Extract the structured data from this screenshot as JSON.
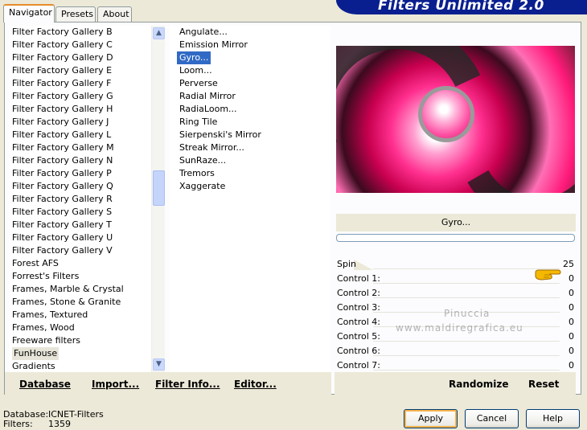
{
  "banner_title": "Filters Unlimited 2.0",
  "tabs": [
    {
      "label": "Navigator",
      "active": true
    },
    {
      "label": "Presets",
      "active": false
    },
    {
      "label": "About",
      "active": false
    }
  ],
  "categories": [
    "Filter Factory Gallery B",
    "Filter Factory Gallery C",
    "Filter Factory Gallery D",
    "Filter Factory Gallery E",
    "Filter Factory Gallery F",
    "Filter Factory Gallery G",
    "Filter Factory Gallery H",
    "Filter Factory Gallery J",
    "Filter Factory Gallery L",
    "Filter Factory Gallery M",
    "Filter Factory Gallery N",
    "Filter Factory Gallery P",
    "Filter Factory Gallery Q",
    "Filter Factory Gallery R",
    "Filter Factory Gallery S",
    "Filter Factory Gallery T",
    "Filter Factory Gallery U",
    "Filter Factory Gallery V",
    "Forest AFS",
    "Forrest's Filters",
    "Frames, Marble & Crystal",
    "Frames, Stone & Granite",
    "Frames, Textured",
    "Frames, Wood",
    "Freeware filters",
    "FunHouse",
    "Gradients"
  ],
  "selected_category": "FunHouse",
  "filters": [
    "Angulate...",
    "Emission Mirror",
    "Gyro...",
    "Loom...",
    "Perverse",
    "Radial Mirror",
    "RadiaLoom...",
    "Ring Tile",
    "Sierpenski's Mirror",
    "Streak Mirror...",
    "SunRaze...",
    "Tremors",
    "Xaggerate"
  ],
  "selected_filter": "Gyro...",
  "left_buttons": {
    "database": "Database",
    "import": "Import...",
    "filter_info": "Filter Info...",
    "editor": "Editor..."
  },
  "filter_name": "Gyro...",
  "controls": [
    {
      "label": "Spin",
      "value": "25"
    },
    {
      "label": "Control 1:",
      "value": "0"
    },
    {
      "label": "Control 2:",
      "value": "0"
    },
    {
      "label": "Control 3:",
      "value": "0"
    },
    {
      "label": "Control 4:",
      "value": "0"
    },
    {
      "label": "Control 5:",
      "value": "0"
    },
    {
      "label": "Control 6:",
      "value": "0"
    },
    {
      "label": "Control 7:",
      "value": "0"
    }
  ],
  "right_buttons": {
    "randomize": "Randomize",
    "reset": "Reset"
  },
  "watermark": "Pinuccia",
  "watermark_url": "www.maldiregrafica.eu",
  "status": {
    "database_label": "Database:",
    "database_value": "ICNET-Filters",
    "filters_label": "Filters:",
    "filters_value": "1359"
  },
  "dialog_buttons": {
    "apply": "Apply",
    "cancel": "Cancel",
    "help": "Help"
  },
  "colors": {
    "selection": "#316ac5",
    "banner": "#0a1f8f",
    "tab_accent": "#e68b2c"
  }
}
